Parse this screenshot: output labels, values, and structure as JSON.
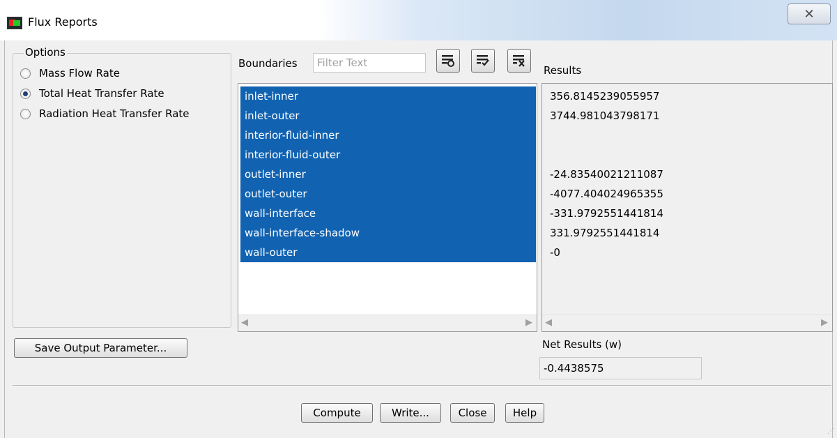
{
  "window": {
    "title": "Flux Reports",
    "close_glyph": "✕",
    "icon": "fluent-app-icon"
  },
  "options": {
    "legend": "Options",
    "radios": [
      {
        "label": "Mass Flow Rate",
        "selected": false
      },
      {
        "label": "Total Heat Transfer Rate",
        "selected": true
      },
      {
        "label": "Radiation Heat Transfer Rate",
        "selected": false
      }
    ]
  },
  "boundaries": {
    "label": "Boundaries",
    "filter_placeholder": "Filter Text",
    "filter_value": "",
    "toolbar_icons": [
      "select-all-icon",
      "deselect-all-icon",
      "clear-filter-icon"
    ],
    "items": [
      "inlet-inner",
      "inlet-outer",
      "interior-fluid-inner",
      "interior-fluid-outer",
      "outlet-inner",
      "outlet-outer",
      "wall-interface",
      "wall-interface-shadow",
      "wall-outer"
    ],
    "selection_color": "#1163b2"
  },
  "results": {
    "label": "Results",
    "values": [
      "356.8145239055957",
      "3744.981043798171",
      "",
      "",
      "-24.83540021211087",
      "-4077.404024965355",
      "-331.9792551441814",
      "331.9792551441814",
      "-0"
    ]
  },
  "save_button": "Save Output Parameter...",
  "net": {
    "label": "Net Results (w)",
    "value": "-0.4438575"
  },
  "buttons": {
    "compute": "Compute",
    "write": "Write...",
    "close": "Close",
    "help": "Help"
  }
}
